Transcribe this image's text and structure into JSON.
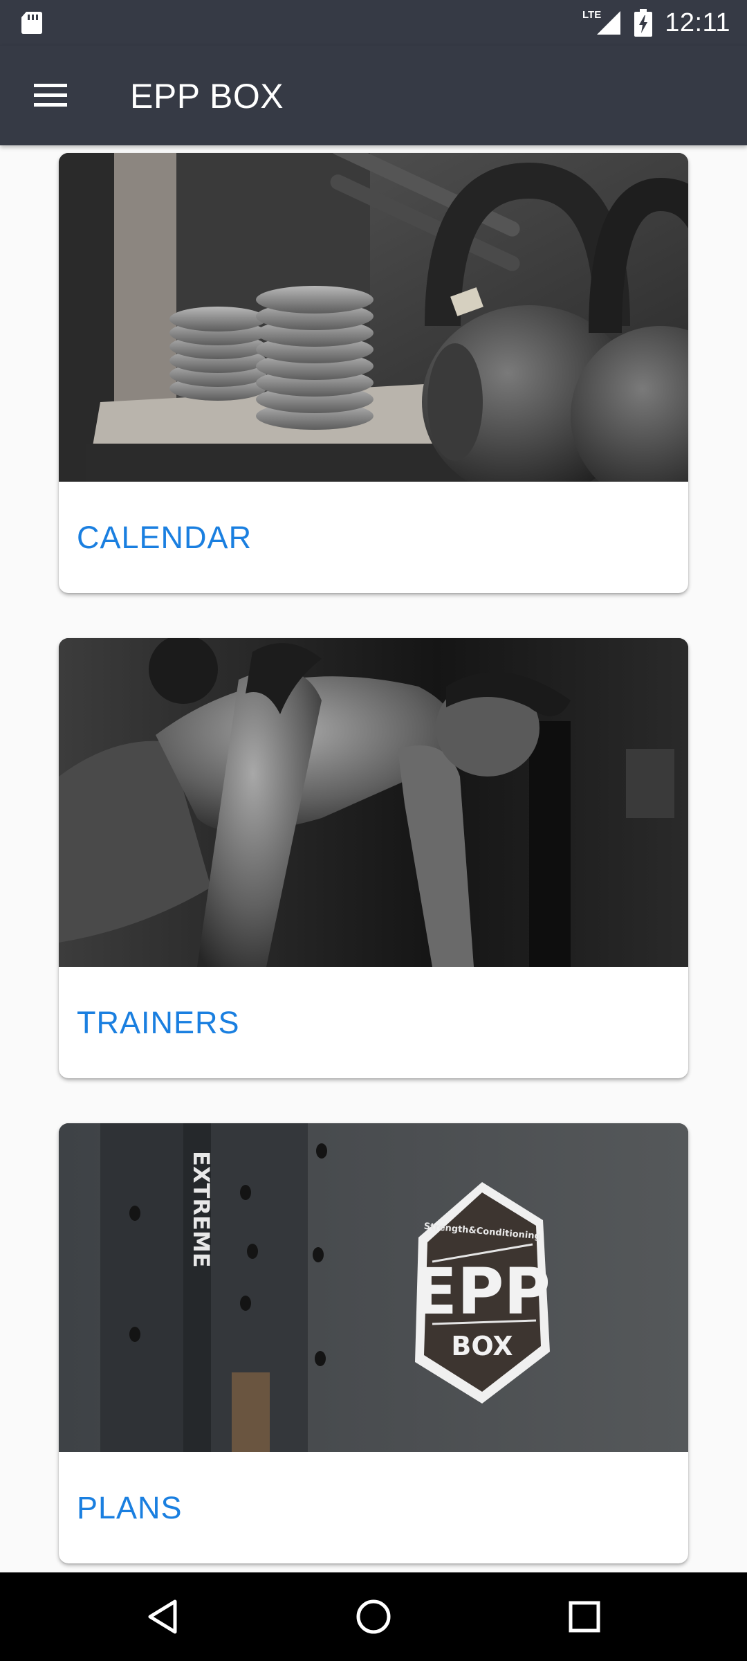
{
  "status_bar": {
    "network": "LTE",
    "time": "12:11",
    "icons": [
      "sd-card-icon",
      "signal-icon",
      "battery-charging-icon"
    ]
  },
  "app_bar": {
    "title": "EPP BOX",
    "menu_icon": "hamburger-menu-icon"
  },
  "cards": [
    {
      "label": "CALENDAR",
      "image": "kettlebells-and-weight-plates-photo"
    },
    {
      "label": "TRAINERS",
      "image": "athlete-training-photo"
    },
    {
      "label": "PLANS",
      "image": "epp-box-logo-wall-photo"
    }
  ],
  "plans_logo": {
    "top": "Strength&Conditioning",
    "main": "EPP",
    "bottom": "BOX"
  },
  "colors": {
    "app_bar": "#363a45",
    "card_label": "#1a7fe0",
    "background": "#fafafa"
  },
  "nav_bar": {
    "icons": [
      "back-icon",
      "home-icon",
      "recents-icon"
    ]
  }
}
